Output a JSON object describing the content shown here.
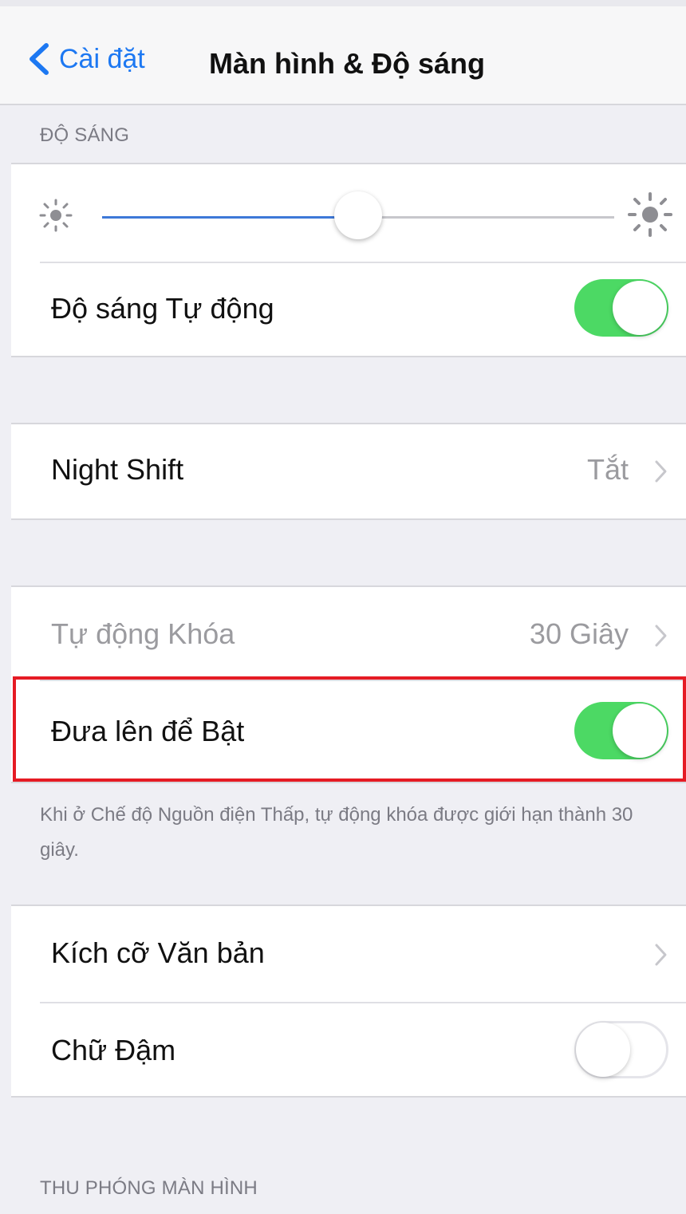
{
  "navigation": {
    "back_label": "Cài đặt",
    "title": "Màn hình & Độ sáng"
  },
  "sections": {
    "brightness_header": "ĐỘ SÁNG",
    "display_zoom_header": "THU PHÓNG MÀN HÌNH"
  },
  "brightness": {
    "level_fraction": 0.5
  },
  "rows": {
    "auto_brightness": {
      "label": "Độ sáng Tự động",
      "enabled": true
    },
    "night_shift": {
      "label": "Night Shift",
      "value": "Tắt"
    },
    "auto_lock": {
      "label": "Tự động Khóa",
      "value": "30 Giây"
    },
    "raise_to_wake": {
      "label": "Đưa lên để Bật",
      "enabled": true
    },
    "low_power_note": "Khi ở Chế độ Nguồn điện Thấp, tự động khóa được giới hạn thành 30 giây.",
    "text_size": {
      "label": "Kích cỡ Văn bản"
    },
    "bold_text": {
      "label": "Chữ Đậm",
      "enabled": false
    }
  },
  "colors": {
    "ios_blue": "#1d78f2",
    "toggle_green": "#4cd964",
    "highlight_red": "#e51b24",
    "grouped_background": "#efeff4"
  },
  "icons": {
    "back": "chevron-left-icon",
    "brightness_min": "sun-small-icon",
    "brightness_max": "sun-large-icon",
    "disclosure": "chevron-right-icon"
  }
}
